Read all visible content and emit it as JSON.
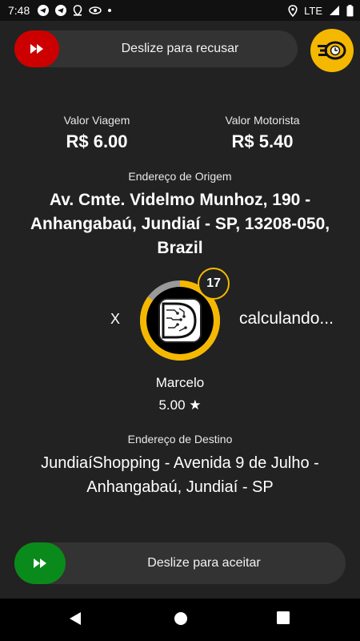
{
  "status_bar": {
    "time": "7:48",
    "network": "LTE",
    "icons": [
      "telegram-icon",
      "telegram-icon",
      "location-pin-icon",
      "eye-icon",
      "dot-icon",
      "location-icon",
      "signal-icon",
      "battery-icon"
    ]
  },
  "decline_slider": {
    "label": "Deslize para recusar",
    "handle_color": "#cc0000",
    "icon": "fast-forward-icon"
  },
  "app_logo": {
    "icon": "speed-clock-logo-icon",
    "color": "#f5b800"
  },
  "fare": {
    "trip_label": "Valor Viagem",
    "trip_value": "R$ 6.00",
    "driver_label": "Valor Motorista",
    "driver_value": "R$ 5.40"
  },
  "origin": {
    "label": "Endereço de Origem",
    "address": "Av. Cmte. Videlmo Munhoz, 190 - Anhangabaú, Jundiaí - SP, 13208-050, Brazil"
  },
  "passenger": {
    "x_mark": "X",
    "countdown": "17",
    "countdown_progress": 0.85,
    "distance_text": "calculando...",
    "name": "Marcelo",
    "rating": "5.00 ★"
  },
  "destination": {
    "label": "Endereço de Destino",
    "address": "JundiaíShopping - Avenida 9 de Julho - Anhangabaú, Jundiaí - SP"
  },
  "accept_slider": {
    "label": "Deslize para aceitar",
    "handle_color": "#0a8a1a",
    "icon": "fast-forward-icon"
  },
  "nav": {
    "back": "back-icon",
    "home": "home-icon",
    "recents": "recents-icon"
  },
  "colors": {
    "background": "#222222",
    "accent": "#f5b800",
    "decline": "#cc0000",
    "accept": "#0a8a1a"
  }
}
